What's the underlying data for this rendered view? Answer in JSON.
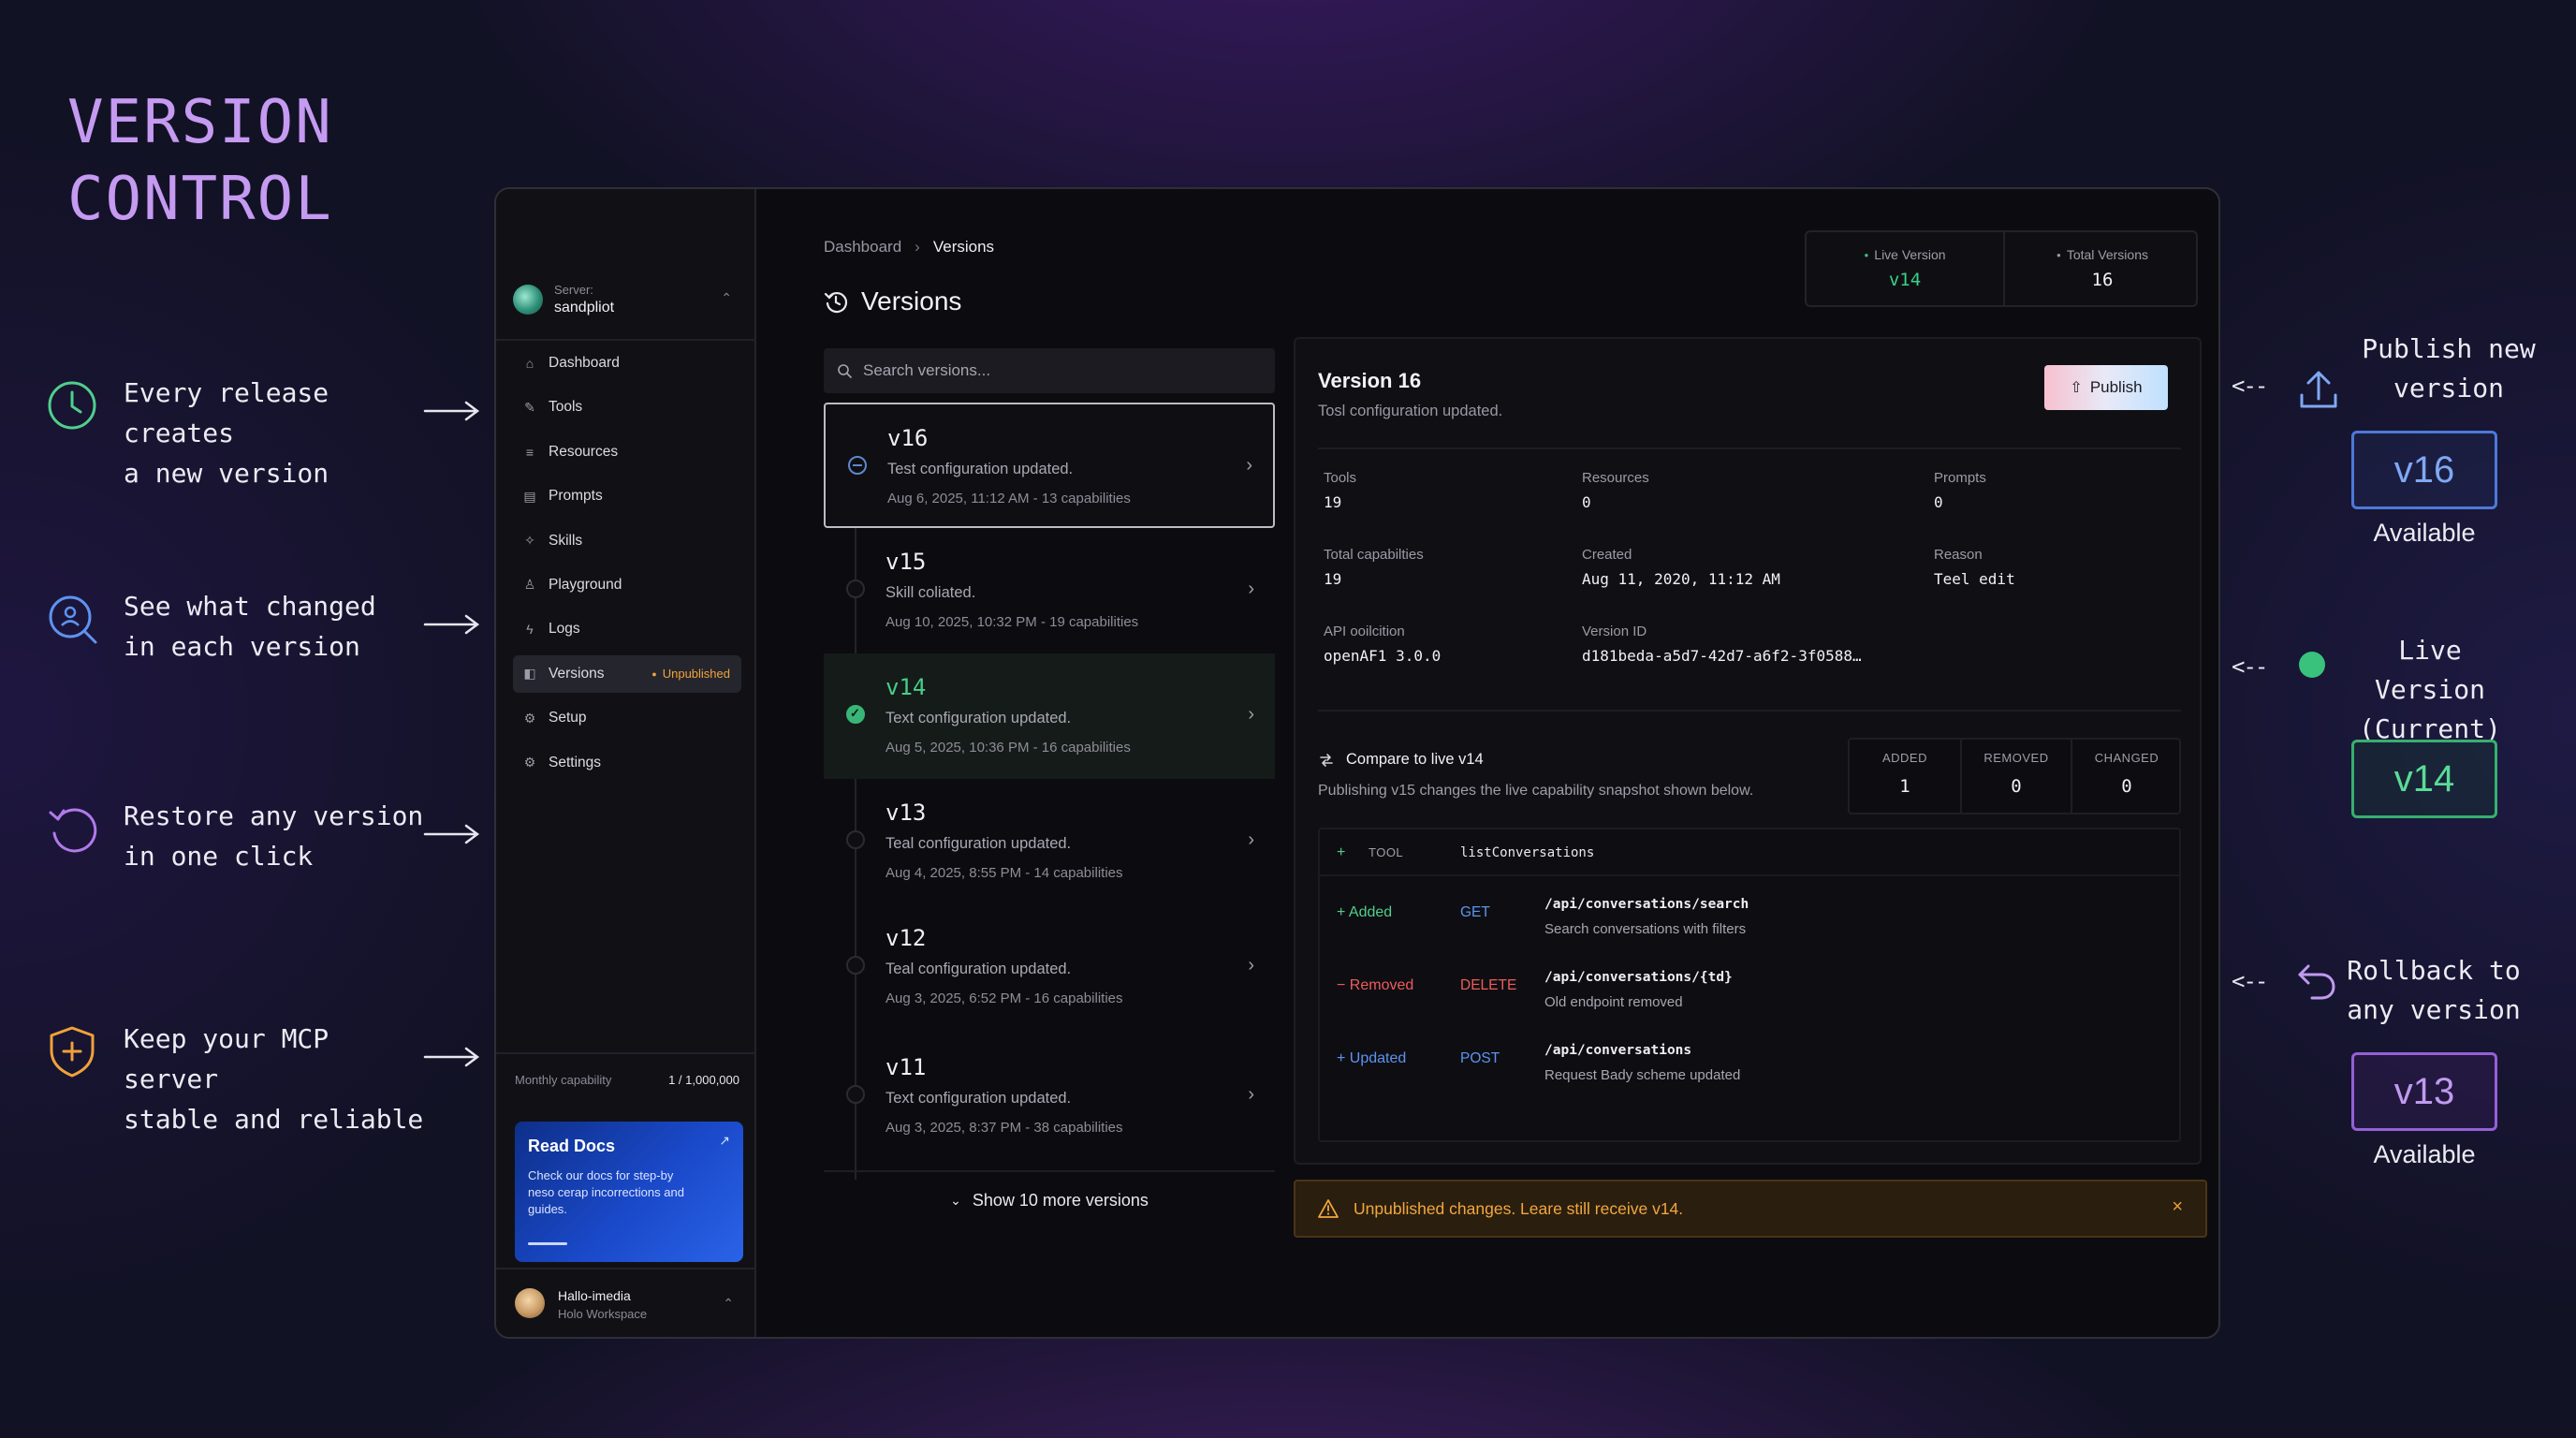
{
  "hero": {
    "title_line1": "VERSION",
    "title_line2": "CONTROL"
  },
  "features": [
    {
      "icon": "clock-icon",
      "line1": "Every release creates",
      "line2": "a new version"
    },
    {
      "icon": "magnifier-icon",
      "line1": "See what changed",
      "line2": "in each version"
    },
    {
      "icon": "restore-icon",
      "line1": "Restore any version",
      "line2": "in one click"
    },
    {
      "icon": "shield-icon",
      "line1": "Keep your MCP server",
      "line2": "stable and reliable"
    }
  ],
  "sidebar": {
    "server_label": "Server:",
    "server_name": "sandpliot",
    "items": [
      {
        "label": "Dashboard",
        "icon": "dashboard-icon"
      },
      {
        "label": "Tools",
        "icon": "wrench-icon"
      },
      {
        "label": "Resources",
        "icon": "database-icon"
      },
      {
        "label": "Prompts",
        "icon": "chat-icon"
      },
      {
        "label": "Skills",
        "icon": "sparkle-icon"
      },
      {
        "label": "Playground",
        "icon": "flask-icon"
      },
      {
        "label": "Logs",
        "icon": "bolt-icon"
      },
      {
        "label": "Versions",
        "icon": "layers-icon",
        "badge": "Unpublished",
        "active": true
      },
      {
        "label": "Setup",
        "icon": "gear-icon"
      },
      {
        "label": "Settings",
        "icon": "gear-icon"
      }
    ],
    "quota_label": "Monthly capability",
    "quota_value": "1 / 1,000,000",
    "docs": {
      "title": "Read Docs",
      "desc": "Check our docs for step-by neso cerap incorrections and guides."
    },
    "user": {
      "name": "Hallo-imedia",
      "workspace": "Holo Workspace"
    }
  },
  "breadcrumb": {
    "root": "Dashboard",
    "current": "Versions"
  },
  "page_title": "Versions",
  "stats": {
    "live_label": "Live Version",
    "live_value": "v14",
    "total_label": "Total Versions",
    "total_value": "16"
  },
  "search": {
    "placeholder": "Search versions..."
  },
  "versions": [
    {
      "tag": "v16",
      "desc": "Test configuration updated.",
      "meta": "Aug 6, 2025, 11:12 AM - 13 capabilities",
      "state": "selected"
    },
    {
      "tag": "v15",
      "desc": "Skill coliated.",
      "meta": "Aug 10, 2025, 10:32 PM - 19 capabilities",
      "state": ""
    },
    {
      "tag": "v14",
      "desc": "Text configuration updated.",
      "meta": "Aug 5, 2025, 10:36 PM - 16 capabilities",
      "state": "live"
    },
    {
      "tag": "v13",
      "desc": "Teal configuration updated.",
      "meta": "Aug 4, 2025, 8:55 PM - 14 capabilities",
      "state": ""
    },
    {
      "tag": "v12",
      "desc": "Teal configuration updated.",
      "meta": "Aug 3, 2025, 6:52 PM - 16 capabilities",
      "state": ""
    },
    {
      "tag": "v11",
      "desc": "Text configuration updated.",
      "meta": "Aug 3, 2025, 8:37 PM - 38 capabilities",
      "state": ""
    }
  ],
  "show_more": "Show 10 more versions",
  "detail": {
    "title": "Version 16",
    "subtitle": "Tosl configuration updated.",
    "publish_label": "Publish",
    "meta": [
      {
        "label": "Tools",
        "value": "19"
      },
      {
        "label": "Resources",
        "value": "0"
      },
      {
        "label": "Prompts",
        "value": "0"
      },
      {
        "label": "Total capabilties",
        "value": "19"
      },
      {
        "label": "Created",
        "value": "Aug 11, 2020, 11:12 AM"
      },
      {
        "label": "Reason",
        "value": "Teel edit"
      },
      {
        "label": "API ooilcition",
        "value": "openAF1 3.0.0"
      },
      {
        "label": "Version ID",
        "value": "d181beda-a5d7-42d7-a6f2-3f0588…"
      }
    ],
    "compare_title": "Compare to live v14",
    "compare_sub": "Publishing v15 changes the live capability snapshot shown below.",
    "counts": [
      {
        "label": "ADDED",
        "value": "1"
      },
      {
        "label": "REMOVED",
        "value": "0"
      },
      {
        "label": "CHANGED",
        "value": "0"
      }
    ],
    "tool_prefix": "+",
    "tool_label": "TOOL",
    "tool_name": "listConversations",
    "changes": [
      {
        "kind": "Added",
        "sign": "+",
        "method": "GET",
        "path": "/api/conversations/search",
        "desc": "Search conversations with filters"
      },
      {
        "kind": "Removed",
        "sign": "−",
        "method": "DELETE",
        "path": "/api/conversations/{td}",
        "desc": "Old endpoint removed"
      },
      {
        "kind": "Updated",
        "sign": "+",
        "method": "POST",
        "path": "/api/conversations",
        "desc": "Request Bady scheme updated"
      }
    ]
  },
  "warning": {
    "text": "Unpublished changes. Leare still receive v14.",
    "close": "×"
  },
  "right_annotations": {
    "publish": {
      "line1": "Publish new",
      "line2": "version",
      "box": "v16",
      "caption": "Available"
    },
    "live": {
      "line1": "Live Version",
      "line2": "(Current)",
      "box": "v14"
    },
    "rollback": {
      "line1": "Rollback to",
      "line2": "any version",
      "box": "v13",
      "caption": "Available"
    }
  },
  "colors": {
    "title_purple": "#c59af1",
    "live_green": "#3ad08a",
    "added_green": "#4fcf8c",
    "removed_red": "#ef5b5b",
    "updated_blue": "#5e93f0",
    "warning_orange": "#f2a73e"
  }
}
